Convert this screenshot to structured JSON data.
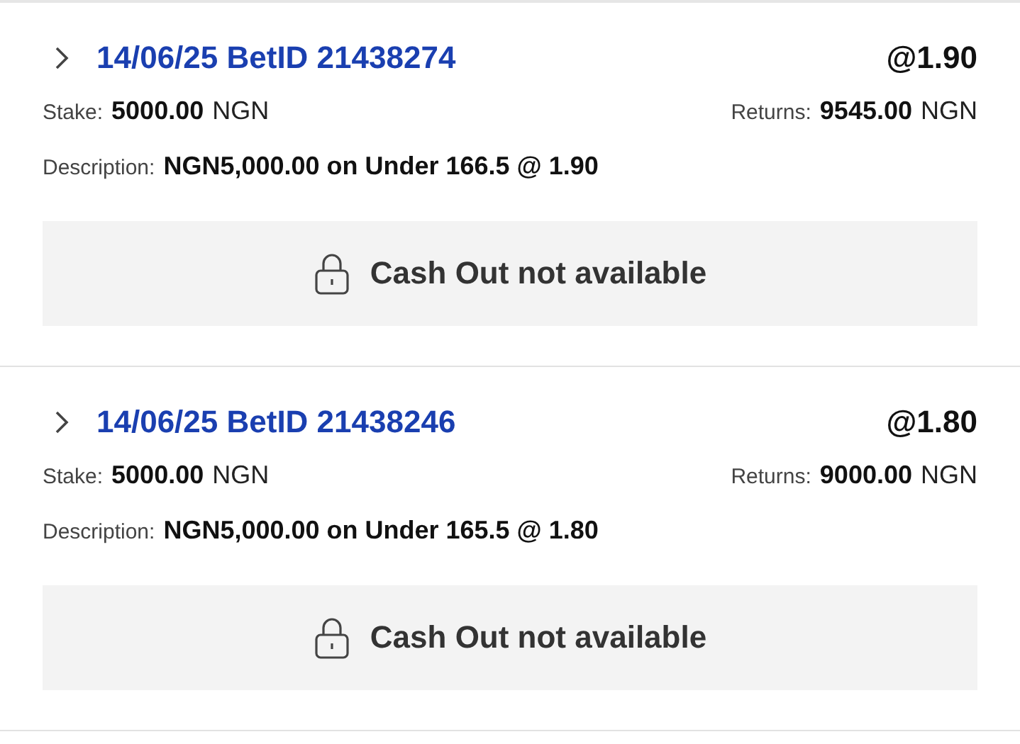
{
  "bets": [
    {
      "title": "14/06/25 BetID 21438274",
      "odds": "@1.90",
      "stake_label": "Stake:",
      "stake": "5000.00",
      "stake_currency": "NGN",
      "returns_label": "Returns:",
      "returns": "9545.00",
      "returns_currency": "NGN",
      "description_label": "Description:",
      "description": "NGN5,000.00 on Under 166.5 @ 1.90",
      "cash_out": {
        "label": "Cash Out not available",
        "available": false
      }
    },
    {
      "title": "14/06/25 BetID 21438246",
      "odds": "@1.80",
      "stake_label": "Stake:",
      "stake": "5000.00",
      "stake_currency": "NGN",
      "returns_label": "Returns:",
      "returns": "9000.00",
      "returns_currency": "NGN",
      "description_label": "Description:",
      "description": "NGN5,000.00 on Under 165.5 @ 1.80",
      "cash_out": {
        "label": "Cash Out not available",
        "available": false
      }
    }
  ]
}
